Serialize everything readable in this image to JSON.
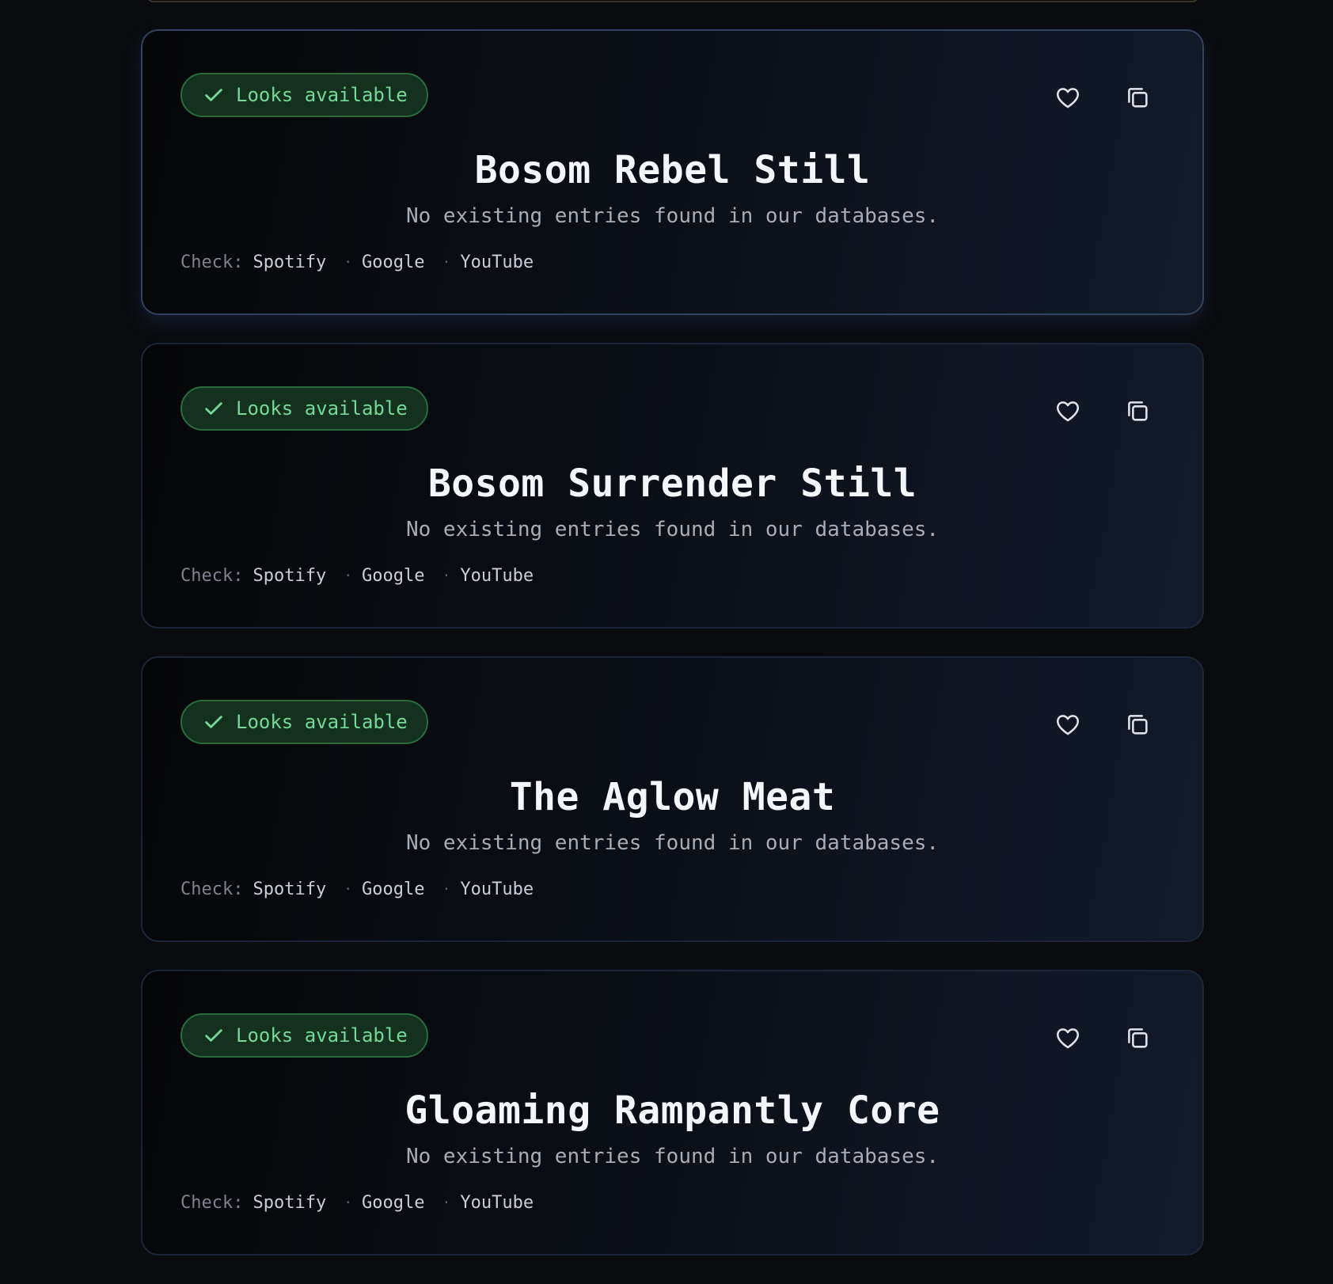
{
  "cards": [
    {
      "status": "Looks available",
      "name": "Bosom Rebel Still",
      "description": "No existing entries found in our databases.",
      "check_label": "Check:",
      "links": [
        "Spotify",
        "Google",
        "YouTube"
      ],
      "active": true
    },
    {
      "status": "Looks available",
      "name": "Bosom Surrender Still",
      "description": "No existing entries found in our databases.",
      "check_label": "Check:",
      "links": [
        "Spotify",
        "Google",
        "YouTube"
      ],
      "active": false
    },
    {
      "status": "Looks available",
      "name": "The Aglow Meat",
      "description": "No existing entries found in our databases.",
      "check_label": "Check:",
      "links": [
        "Spotify",
        "Google",
        "YouTube"
      ],
      "active": false
    },
    {
      "status": "Looks available",
      "name": "Gloaming Rampantly Core",
      "description": "No existing entries found in our databases.",
      "check_label": "Check:",
      "links": [
        "Spotify",
        "Google",
        "YouTube"
      ],
      "active": false
    }
  ],
  "icons": {
    "status": "check-icon",
    "favorite": "heart-icon",
    "copy": "copy-icon",
    "link_separator": "·"
  },
  "colors": {
    "page_background": "#0a0b0e",
    "card_border": "#1d2638",
    "badge_background": "#14311f",
    "badge_text": "#74d996",
    "badge_border": "#2a6b3e",
    "title_text": "#f4f6fa",
    "description_text": "#a7adb8"
  }
}
